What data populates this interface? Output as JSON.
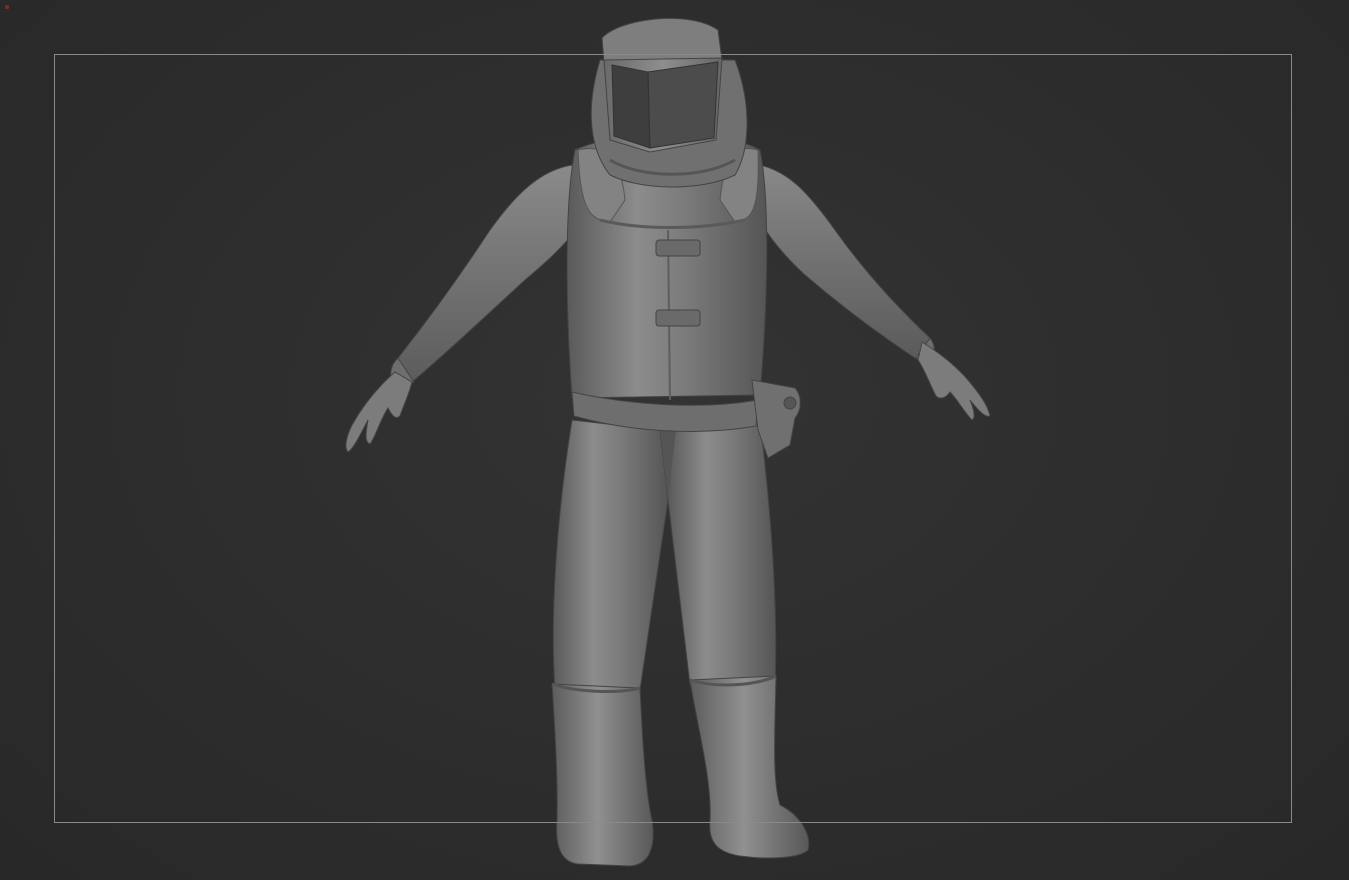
{
  "viewport": {
    "background": "#2c2c2c",
    "frame_color": "#8a8a8a",
    "model_color": "#7a7a7a",
    "model_subject": "hazmat-suit-figure"
  }
}
